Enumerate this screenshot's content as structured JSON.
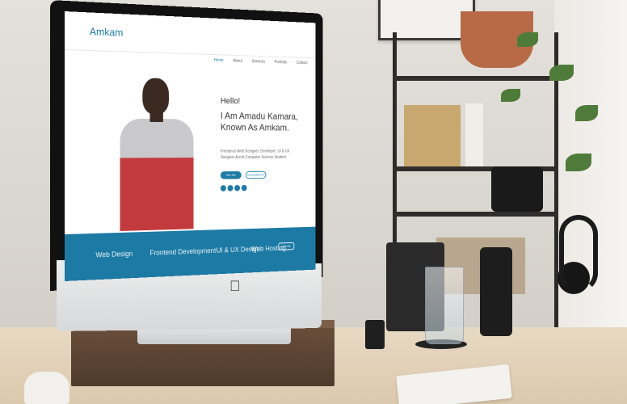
{
  "site": {
    "brand": "Amkam",
    "nav": [
      "Home",
      "About",
      "Services",
      "Portfolio",
      "Contact"
    ],
    "hero": {
      "greeting": "Hello!",
      "headline": "I Am Amadu Kamara, Known As Amkam.",
      "tagline": "Freelance Web Designer, Developer, UI & UX Designer And A Computer Science Student.",
      "primary_button": "Hire Me",
      "secondary_button": "Download CV"
    },
    "services": [
      "Web Design",
      "Frontend Development",
      "UI & UX Design",
      "Web Hosting"
    ],
    "services_button": "Hire Me"
  },
  "colors": {
    "accent": "#1c7aa5",
    "sweater_red": "#c33a3e"
  },
  "icons": [
    "apple-logo",
    "facebook-icon",
    "twitter-icon",
    "linkedin-icon",
    "instagram-icon"
  ]
}
